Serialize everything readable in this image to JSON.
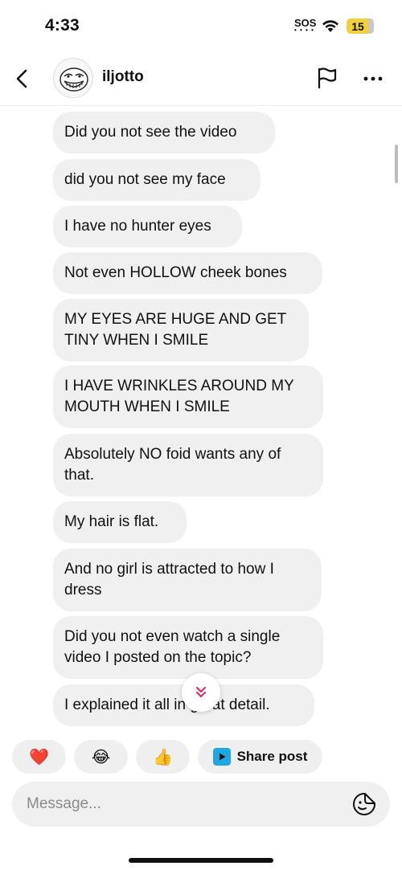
{
  "status_bar": {
    "time": "4:33",
    "sos": "SOS",
    "battery": "15"
  },
  "header": {
    "username": "iljotto"
  },
  "messages": [
    "Did you not see the video",
    "did you not see my face",
    "I have no hunter eyes",
    "Not even HOLLOW cheek bones",
    "MY EYES ARE HUGE AND GET TINY WHEN I SMILE",
    "I HAVE WRINKLES AROUND MY MOUTH WHEN I SMILE",
    "Absolutely NO foid wants any of that.",
    "My hair is flat.",
    "And no girl is attracted to how I dress",
    "Did you not even watch a single video I posted on the topic?",
    "I explained it all in great detail."
  ],
  "quick_replies": {
    "emojis": [
      "❤️",
      "😂",
      "👍"
    ],
    "share_label": "Share post"
  },
  "composer": {
    "placeholder": "Message..."
  },
  "colors": {
    "bubble": "#f0f0f0",
    "accent_red": "#e0245e",
    "share_blue": "#1ea7e1",
    "battery": "#f2d13a"
  },
  "icons": [
    "back-icon",
    "flag-icon",
    "more-icon",
    "chevron-double-down-icon",
    "play-share-icon",
    "sticker-icon",
    "wifi-icon"
  ]
}
